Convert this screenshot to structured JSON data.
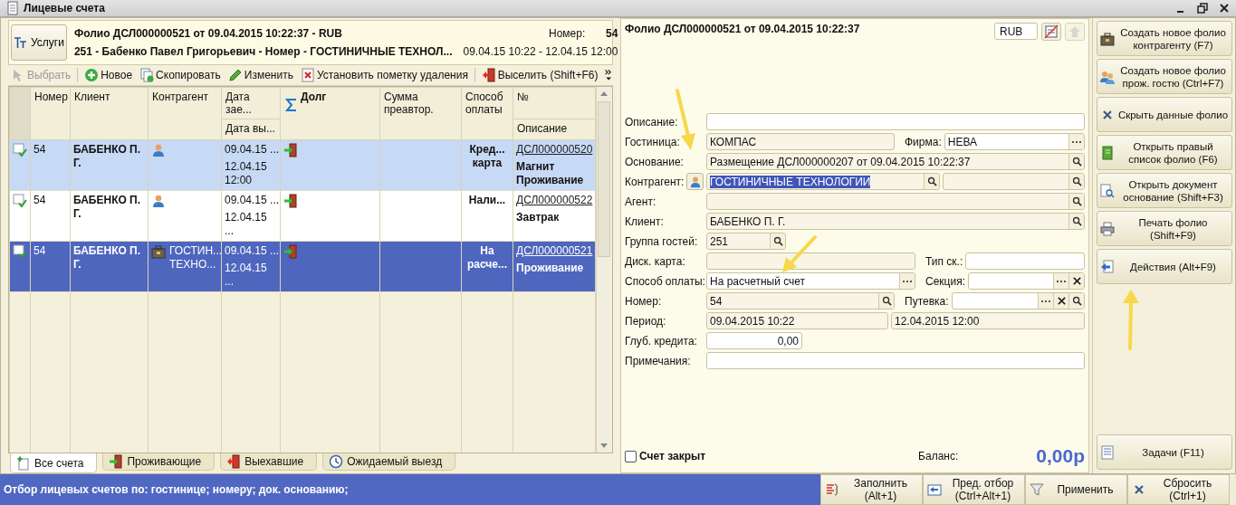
{
  "window": {
    "title": "Лицевые счета"
  },
  "header": {
    "button": "Услуги",
    "title": "Фолио ДСЛ000000521 от 09.04.2015 10:22:37 - RUB",
    "subtitle": "251 - Бабенко Павел Григорьевич - Номер - ГОСТИНИЧНЫЕ ТЕХНОЛ...",
    "number_label": "Номер:",
    "number": "54",
    "period": "09.04.15 10:22 - 12.04.15 12:00"
  },
  "toolbar": [
    {
      "label": "Выбрать",
      "kind": "select",
      "disabled": true
    },
    {
      "label": "Новое",
      "kind": "plus",
      "disabled": false
    },
    {
      "label": "Скопировать",
      "kind": "copy",
      "disabled": false
    },
    {
      "label": "Изменить",
      "kind": "pencil",
      "disabled": false
    },
    {
      "label": "Установить пометку удаления",
      "kind": "delete",
      "disabled": false
    },
    {
      "label": "Выселить (Shift+F6)",
      "kind": "evict",
      "disabled": false
    }
  ],
  "table": {
    "columns": [
      {
        "label": "Номер"
      },
      {
        "label": "Клиент"
      },
      {
        "label": "Контрагент"
      },
      {
        "label": "Дата зае...",
        "sub": "Дата вы..."
      },
      {
        "label": "Долг",
        "kind": "sum"
      },
      {
        "label": "Сумма преавтор."
      },
      {
        "label": "Способ оплаты"
      },
      {
        "label": "№",
        "sub": "Описание"
      }
    ],
    "rows": [
      {
        "number": "54",
        "client": "БАБЕНКО П. Г.",
        "contragent": {
          "kind": "person"
        },
        "date_in": "09.04.15 ...",
        "date_out": "12.04.15 12:00",
        "debt": {
          "kind": "enter"
        },
        "payment": "Кред... карта",
        "doc": "ДСЛ000000520",
        "description": "Магнит Проживание",
        "highlighted": true,
        "selected": false
      },
      {
        "number": "54",
        "client": "БАБЕНКО П. Г.",
        "contragent": {
          "kind": "person"
        },
        "date_in": "09.04.15 ...",
        "date_out": "12.04.15 ...",
        "debt": {
          "kind": "enter"
        },
        "payment": "Нали...",
        "doc": "ДСЛ000000522",
        "description": "Завтрак",
        "highlighted": false,
        "selected": false
      },
      {
        "number": "54",
        "client": "БАБЕНКО П. Г.",
        "contragent": {
          "kind": "company",
          "name": "ГОСТИН... ТЕХНО..."
        },
        "date_in": "09.04.15 ...",
        "date_out": "12.04.15 ...",
        "debt": {
          "kind": "enter"
        },
        "payment": "На расче...",
        "doc": "ДСЛ000000521",
        "description": "Проживание",
        "highlighted": false,
        "selected": true
      }
    ]
  },
  "tabs": [
    {
      "label": "Все счета",
      "kind": "add-doc",
      "selected": true
    },
    {
      "label": "Проживающие",
      "kind": "enter",
      "selected": false
    },
    {
      "label": "Выехавшие",
      "kind": "evict",
      "selected": false
    },
    {
      "label": "Ожидаемый выезд",
      "kind": "clock",
      "selected": false
    }
  ],
  "folio": {
    "title": "Фолио ДСЛ000000521 от 09.04.2015 10:22:37",
    "currency": "RUB",
    "fields": [
      {
        "label": "Описание:",
        "inputs": [
          {
            "editable": true
          }
        ]
      },
      {
        "label": "Гостиница:",
        "inputs": [
          {
            "value": "КОМПАС",
            "editable": false
          },
          {
            "label": "Фирма:",
            "value": "НЕВА",
            "editable": true,
            "buttons": [
              {
                "kind": "select"
              }
            ]
          }
        ]
      },
      {
        "label": "Основание:",
        "inputs": [
          {
            "value": "Размещение ДСЛ000000207 от 09.04.2015 10:22:37",
            "editable": false,
            "buttons": [
              {
                "kind": "search"
              }
            ]
          }
        ]
      },
      {
        "label": "Контрагент:",
        "person_button": true,
        "inputs": [
          {
            "value": "ГОСТИНИЧНЫЕ ТЕХНОЛОГИИ",
            "editable": false,
            "highlighted": true,
            "buttons": [
              {
                "kind": "search"
              }
            ]
          },
          {
            "editable": false,
            "buttons": [
              {
                "kind": "search"
              }
            ]
          }
        ]
      },
      {
        "label": "Агент:",
        "inputs": [
          {
            "editable": false,
            "buttons": [
              {
                "kind": "search"
              }
            ]
          }
        ]
      },
      {
        "label": "Клиент:",
        "inputs": [
          {
            "value": "БАБЕНКО П. Г.",
            "editable": false,
            "buttons": [
              {
                "kind": "search"
              }
            ]
          }
        ]
      },
      {
        "label": "Группа гостей:",
        "inputs": [
          {
            "value": "251",
            "editable": false,
            "buttons": [
              {
                "kind": "search"
              }
            ]
          }
        ]
      },
      {
        "label": "Диск. карта:",
        "inputs": [
          {
            "editable": false
          },
          {
            "label": "Тип ск.:",
            "editable": true
          }
        ]
      },
      {
        "label": "Способ оплаты:",
        "inputs": [
          {
            "value": "На расчетный счет",
            "editable": true,
            "buttons": [
              {
                "kind": "select"
              }
            ]
          },
          {
            "label": "Секция:",
            "editable": true,
            "buttons": [
              {
                "kind": "select"
              },
              {
                "kind": "clear"
              }
            ]
          }
        ]
      },
      {
        "label": "Номер:",
        "inputs": [
          {
            "value": "54",
            "editable": false,
            "buttons": [
              {
                "kind": "search"
              }
            ]
          },
          {
            "label": "Путевка:",
            "editable": true,
            "buttons": [
              {
                "kind": "select"
              },
              {
                "kind": "clear"
              },
              {
                "kind": "search"
              }
            ]
          }
        ]
      },
      {
        "label": "Период:",
        "inputs": [
          {
            "value": "09.04.2015 10:22",
            "editable": false
          },
          {
            "value": "12.04.2015 12:00",
            "editable": false
          }
        ]
      },
      {
        "label": "Глуб. кредита:",
        "inputs": [
          {
            "value": "0,00",
            "kind": "amount",
            "editable": true
          }
        ]
      },
      {
        "label": "Примечания:",
        "inputs": [
          {
            "editable": true
          }
        ]
      }
    ],
    "closed": {
      "label": "Счет закрыт",
      "checked": false
    },
    "balance_label": "Баланс:",
    "balance": "0,00р"
  },
  "actions": [
    {
      "label": "Создать новое фолио контрагенту (F7)",
      "kind": "briefcase"
    },
    {
      "label": "Создать новое фолио прож. гостю (Ctrl+F7)",
      "kind": "people"
    },
    {
      "label": "Скрыть данные фолио",
      "kind": "x"
    },
    {
      "label": "Открыть правый список фолио (F6)",
      "kind": "book"
    },
    {
      "label": "Открыть документ основание (Shift+F3)",
      "kind": "search-doc"
    },
    {
      "label": "Печать фолио (Shift+F9)",
      "kind": "printer"
    },
    {
      "label": "Действия (Alt+F9)",
      "kind": "arrow-doc"
    }
  ],
  "tasks": {
    "label": "Задачи (F11)",
    "kind": "list"
  },
  "status_bar": {
    "filter": "Отбор лицевых счетов по: гостинице; номеру; док. основанию;",
    "buttons": [
      {
        "label": "Заполнить (Alt+1)",
        "kind": "fill"
      },
      {
        "label": "Пред. отбор (Ctrl+Alt+1)",
        "kind": "back"
      },
      {
        "label": "Применить",
        "kind": "filter"
      },
      {
        "label": "Сбросить (Ctrl+1)",
        "kind": "x"
      }
    ]
  }
}
